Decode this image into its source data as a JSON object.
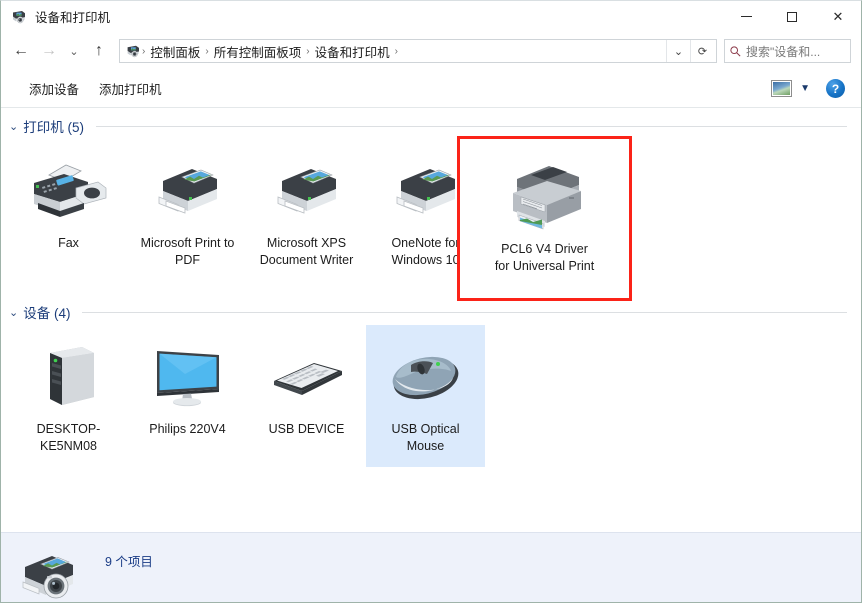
{
  "window": {
    "title": "设备和打印机",
    "title_icon": "printer-camera-icon",
    "minimize_label": "最小化",
    "maximize_label": "最大化",
    "close_label": "关闭"
  },
  "addressbar": {
    "back_icon": "back-arrow-icon",
    "forward_icon": "forward-arrow-icon",
    "recent_icon": "chevron-down-icon",
    "up_icon": "up-arrow-icon",
    "crumb_icon": "printer-camera-icon",
    "breadcrumbs": [
      "控制面板",
      "所有控制面板项",
      "设备和打印机"
    ],
    "dropdown_icon": "chevron-down-icon",
    "refresh_icon": "refresh-icon",
    "separator": "›"
  },
  "search": {
    "icon": "search-icon",
    "placeholder": "搜索\"设备和..."
  },
  "toolbar": {
    "add_device_label": "添加设备",
    "add_printer_label": "添加打印机",
    "view_icon": "preview-pane-icon",
    "view_chevron": "chevron-down-icon",
    "help_icon": "help-icon",
    "help_label": "?"
  },
  "groups": [
    {
      "id": "printers",
      "label": "打印机 (5)",
      "chevron": "chevron-collapse-icon",
      "items": [
        {
          "label": "Fax",
          "icon": "fax-machine-icon",
          "selected": false,
          "highlighted": false
        },
        {
          "label": "Microsoft Print to PDF",
          "icon": "printer-icon",
          "selected": false,
          "highlighted": false
        },
        {
          "label": "Microsoft XPS Document Writer",
          "icon": "printer-icon",
          "selected": false,
          "highlighted": false
        },
        {
          "label": "OneNote for Windows 10",
          "icon": "printer-icon",
          "selected": false,
          "highlighted": false
        },
        {
          "label": "PCL6 V4 Driver for Universal Print",
          "icon": "multifunction-printer-icon",
          "selected": false,
          "highlighted": true
        }
      ]
    },
    {
      "id": "devices",
      "label": "设备 (4)",
      "chevron": "chevron-collapse-icon",
      "items": [
        {
          "label": "DESKTOP-KE5NM08",
          "icon": "desktop-tower-icon",
          "selected": false,
          "highlighted": false
        },
        {
          "label": "Philips 220V4",
          "icon": "monitor-icon",
          "selected": false,
          "highlighted": false
        },
        {
          "label": "USB DEVICE",
          "icon": "keyboard-icon",
          "selected": false,
          "highlighted": false
        },
        {
          "label": "USB Optical Mouse",
          "icon": "mouse-icon",
          "selected": true,
          "highlighted": false
        }
      ]
    }
  ],
  "annotation": {
    "type": "red-rectangle",
    "color": "#fb2318",
    "target": "PCL6 V4 Driver for Universal Print"
  },
  "statusbar": {
    "icon": "printer-camera-icon",
    "item_count_label": "9 个项目"
  },
  "colors": {
    "selection": "#dbeafc",
    "group_header_text": "#1c3d7a",
    "status_text": "#1b3d86",
    "status_bg": "#eef2fa",
    "annotation": "#fb2318"
  }
}
